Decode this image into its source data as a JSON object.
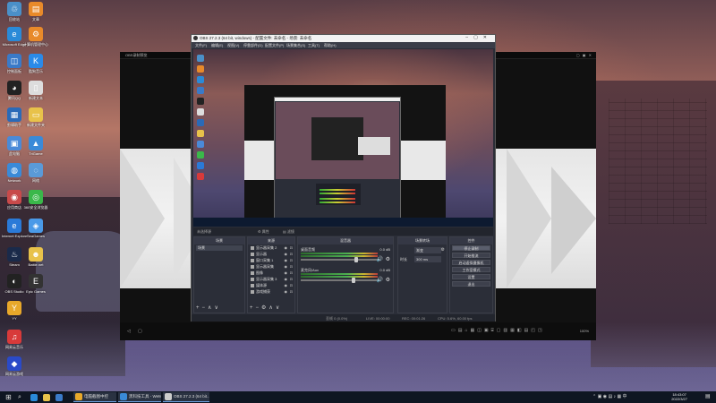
{
  "desktop": {
    "icons": [
      {
        "label": "回收站",
        "icon": "recycle-bin-icon",
        "color": "#4a90c8",
        "glyph": "♲"
      },
      {
        "label": "文章",
        "icon": "folder-icon",
        "color": "#e88a2a",
        "glyph": "▤"
      },
      {
        "label": "Microsoft Edge",
        "icon": "edge-icon",
        "color": "#2a8ad8",
        "glyph": "e"
      },
      {
        "label": "计算机管理中心",
        "icon": "app-icon",
        "color": "#e88a2a",
        "glyph": "⚙"
      },
      {
        "label": "控制面板",
        "icon": "control-panel-icon",
        "color": "#3a7ac8",
        "glyph": "◫"
      },
      {
        "label": "酷狗音乐",
        "icon": "kugou-icon",
        "color": "#2a8ae8",
        "glyph": "K"
      },
      {
        "label": "腾讯QQ",
        "icon": "qq-icon",
        "color": "#222222",
        "glyph": "◕"
      },
      {
        "label": "新建文本",
        "icon": "text-file-icon",
        "color": "#dddddd",
        "glyph": "▯"
      },
      {
        "label": "剪辑助手",
        "icon": "app-icon",
        "color": "#2a6ab8",
        "glyph": "▦"
      },
      {
        "label": "新建文件夹",
        "icon": "folder-icon",
        "color": "#e8c24a",
        "glyph": "▭"
      },
      {
        "label": "此电脑",
        "icon": "computer-icon",
        "color": "#4a8ad8",
        "glyph": "▣"
      },
      {
        "label": "TriGame",
        "icon": "game-icon",
        "color": "#3a8ad8",
        "glyph": "▲"
      },
      {
        "label": "Network",
        "icon": "network-icon",
        "color": "#3a8ad8",
        "glyph": "◍"
      },
      {
        "label": "网络",
        "icon": "network-icon",
        "color": "#5a9ad8",
        "glyph": "◌"
      },
      {
        "label": "应用商店",
        "icon": "store-icon",
        "color": "#c84a4a",
        "glyph": "◉"
      },
      {
        "label": "360安全浏览器",
        "icon": "browser-icon",
        "color": "#3ab84a",
        "glyph": "◎"
      },
      {
        "label": "Internet Explorer",
        "icon": "ie-icon",
        "color": "#2a7ad8",
        "glyph": "e"
      },
      {
        "label": "SeaGames",
        "icon": "game-icon",
        "color": "#4a9ae8",
        "glyph": "◈"
      },
      {
        "label": "Steam",
        "icon": "steam-icon",
        "color": "#1a2a4a",
        "glyph": "♨"
      },
      {
        "label": "Battle.net",
        "icon": "battlenet-icon",
        "color": "#e8c24a",
        "glyph": "☻"
      },
      {
        "label": "OBS Studio",
        "icon": "obs-icon",
        "color": "#222222",
        "glyph": "◐"
      },
      {
        "label": "Epic Games",
        "icon": "epic-icon",
        "color": "#333333",
        "glyph": "E"
      },
      {
        "label": "YY",
        "icon": "yy-icon",
        "color": "#e8a82a",
        "glyph": "Y"
      },
      {
        "label": "网易云音乐",
        "icon": "music-icon",
        "color": "#d83a3a",
        "glyph": "♫"
      },
      {
        "label": "网易云游戏",
        "icon": "game-icon",
        "color": "#2a4ac8",
        "glyph": "◆"
      }
    ]
  },
  "outer_preview": {
    "title": "OBS录制预览",
    "zoom": "100%"
  },
  "obs": {
    "title": "OBS 27.2.3 (64 bit, windows) - 配置文件: 未命名 - 场景: 未命名",
    "menu": [
      "文件(F)",
      "编辑(E)",
      "视图(V)",
      "停靠部件(D)",
      "配置文件(P)",
      "场景集合(S)",
      "工具(T)",
      "帮助(H)"
    ],
    "no_source": "未选择源",
    "source_props": "属性",
    "source_filters": "滤镜",
    "docks": {
      "scenes": {
        "title": "场景",
        "items": [
          "场景"
        ]
      },
      "sources": {
        "title": "来源",
        "items": [
          "显示器采集 2",
          "显示器",
          "窗口采集 1",
          "显示器采集",
          "图像",
          "显示器采集 3",
          "媒体源",
          "游戏捕获"
        ]
      },
      "mixer": {
        "title": "混音器",
        "channels": [
          {
            "name": "桌面音频",
            "db": "0.0 dB",
            "level": 0.7
          },
          {
            "name": "麦克风/Aux",
            "db": "0.0 dB",
            "level": 0.66
          }
        ]
      },
      "transitions": {
        "title": "场景转场",
        "type_label": "渐变",
        "duration_label": "时长",
        "duration_value": "300 ms"
      },
      "controls": {
        "title": "控件",
        "buttons": [
          "停止录制",
          "开始推流",
          "启动虚拟摄像机",
          "工作室模式",
          "设置",
          "退出"
        ]
      }
    },
    "status": {
      "dropped": "丢帧 0 (0.0%)",
      "live": "LIVE: 00:00:00",
      "rec": "REC: 00:01:26",
      "cpu": "CPU: 5.6%, 60.00 fps"
    }
  },
  "taskbar": {
    "apps": [
      {
        "label": "电脑截图中控",
        "icon": "folder-icon",
        "color": "#e8a82a"
      },
      {
        "label": "黑科技工具 - WeMa...",
        "icon": "app-icon",
        "color": "#3a8ad8"
      },
      {
        "label": "OBS 27.2.3 (64 bit...",
        "icon": "obs-icon",
        "color": "#cccccc"
      }
    ],
    "time": "18:43:07",
    "date": "2022/3/27"
  }
}
